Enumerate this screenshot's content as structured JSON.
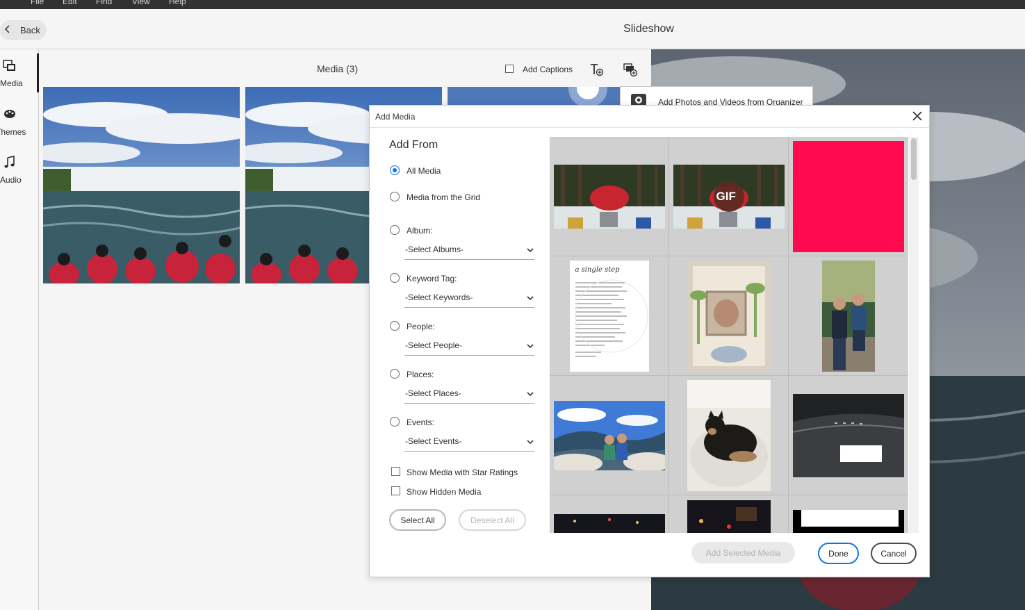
{
  "menu": [
    "File",
    "Edit",
    "Find",
    "View",
    "Help"
  ],
  "header": {
    "back_label": "Back",
    "title": "Slideshow"
  },
  "nav": {
    "media": "Media",
    "themes": "Themes",
    "audio": "Audio"
  },
  "media_panel": {
    "title": "Media (3)",
    "add_captions": "Add Captions"
  },
  "organizer_popup": {
    "label": "Add Photos and Videos from Organizer"
  },
  "dialog": {
    "title": "Add Media",
    "add_from": "Add From",
    "radios": {
      "all_media": "All Media",
      "media_grid": "Media from the Grid",
      "album": "Album:",
      "keyword": "Keyword Tag:",
      "people": "People:",
      "places": "Places:",
      "events": "Events:"
    },
    "selects": {
      "albums": "-Select Albums-",
      "keywords": "-Select Keywords-",
      "people": "-Select People-",
      "places": "-Select Places-",
      "events": "-Select Events-"
    },
    "checkboxes": {
      "star": "Show Media with Star Ratings",
      "hidden": "Show Hidden Media"
    },
    "buttons": {
      "select_all": "Select All",
      "deselect_all": "Deselect All",
      "add_selected": "Add Selected Media",
      "done": "Done",
      "cancel": "Cancel"
    },
    "gif_badge": "GIF",
    "quote_text": "a single step"
  },
  "colors": {
    "accent": "#1473e6",
    "pink_tile": "#ff0a4f"
  }
}
